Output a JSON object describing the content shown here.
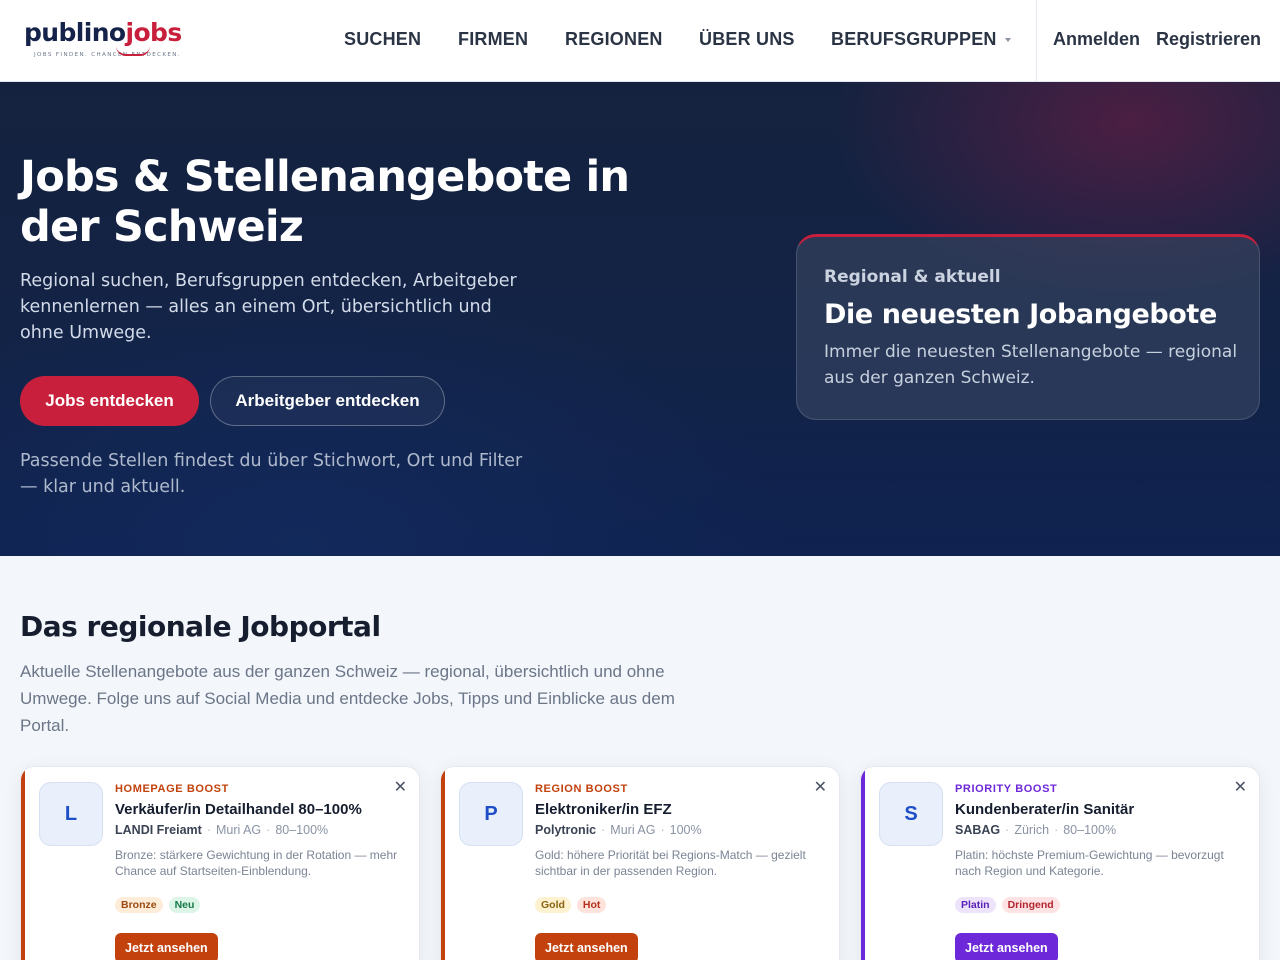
{
  "header": {
    "logo": {
      "part1": "publino",
      "part2": "jobs",
      "tagline": "JOBS FINDEN. CHANCEN ENTDECKEN."
    },
    "nav": [
      {
        "label": "SUCHEN"
      },
      {
        "label": "FIRMEN"
      },
      {
        "label": "REGIONEN"
      },
      {
        "label": "ÜBER UNS"
      },
      {
        "label": "BERUFSGRUPPEN"
      }
    ],
    "login": "Anmelden",
    "register": "Registrieren"
  },
  "hero": {
    "title": "Jobs & Stellenangebote in der Schweiz",
    "subtitle": "Regional suchen, Berufsgruppen entdecken, Arbeitgeber kennenlernen — alles an einem Ort, übersichtlich und ohne Umwege.",
    "primary_button": "Jobs entdecken",
    "secondary_button": "Arbeitgeber entdecken",
    "note": "Passende Stellen findest du über Stichwort, Ort und Filter — klar und aktuell.",
    "card": {
      "kicker": "Regional & aktuell",
      "title": "Die neuesten Jobangebote",
      "text": "Immer die neuesten Stellenangebote — regional aus der ganzen Schweiz."
    }
  },
  "section": {
    "title": "Das regionale Jobportal",
    "text": "Aktuelle Stellenangebote aus der ganzen Schweiz — regional, übersichtlich und ohne Umwege. Folge uns auf Social Media und entdecke Jobs, Tipps und Einblicke aus dem Portal."
  },
  "jobs": [
    {
      "initial": "L",
      "boost": "HOMEPAGE BOOST",
      "title": "Verkäufer/in Detailhandel 80–100%",
      "company": "LANDI Freiamt",
      "location": "Muri AG",
      "workload": "80–100%",
      "description": "Bronze: stärkere Gewichtung in der Rotation — mehr Chance auf Startseiten-Einblendung.",
      "tags": [
        "Bronze",
        "Neu"
      ],
      "button": "Jetzt ansehen",
      "accent": "#c2410c"
    },
    {
      "initial": "P",
      "boost": "REGION BOOST",
      "title": "Elektroniker/in EFZ",
      "company": "Polytronic",
      "location": "Muri AG",
      "workload": "100%",
      "description": "Gold: höhere Priorität bei Regions-Match — gezielt sichtbar in der passenden Region.",
      "tags": [
        "Gold",
        "Hot"
      ],
      "button": "Jetzt ansehen",
      "accent": "#c2410c"
    },
    {
      "initial": "S",
      "boost": "PRIORITY BOOST",
      "title": "Kundenberater/in Sanitär",
      "company": "SABAG",
      "location": "Zürich",
      "workload": "80–100%",
      "description": "Platin: höchste Premium-Gewichtung — bevorzugt nach Region und Kategorie.",
      "tags": [
        "Platin",
        "Dringend"
      ],
      "button": "Jetzt ansehen",
      "accent": "#6d28d9"
    }
  ],
  "colors": {
    "brand_red": "#c8203c",
    "brand_navy": "#15234a",
    "boost_orange": "#c2410c",
    "boost_purple": "#6d28d9"
  }
}
